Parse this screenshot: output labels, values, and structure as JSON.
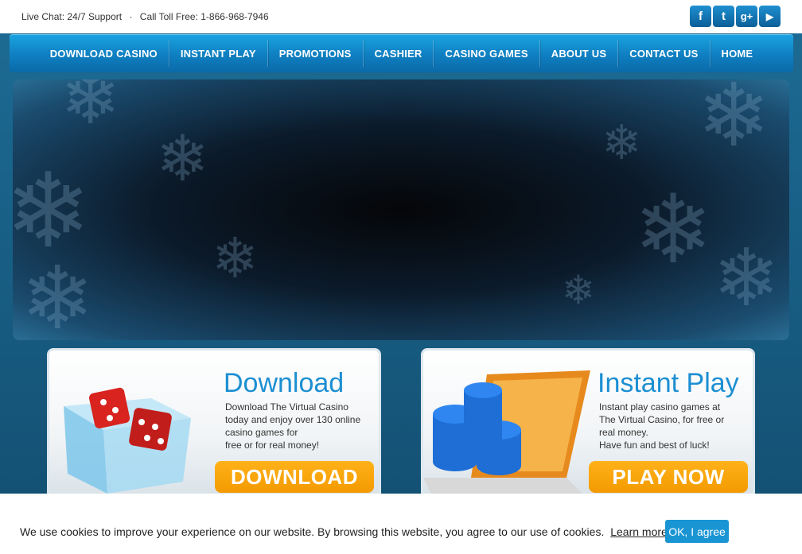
{
  "topbar": {
    "live_chat": "Live Chat: 24/7 Support",
    "separator": "·",
    "toll_free": "Call Toll Free: 1-866-968-7946"
  },
  "social": {
    "facebook_glyph": "f",
    "twitter_glyph": "t",
    "googleplus_glyph": "g+",
    "youtube_glyph": "▶"
  },
  "nav": {
    "items": [
      "DOWNLOAD CASINO",
      "INSTANT PLAY",
      "PROMOTIONS",
      "CASHIER",
      "CASINO GAMES",
      "ABOUT US",
      "CONTACT US",
      "HOME"
    ]
  },
  "download_panel": {
    "title": "Download",
    "lines": [
      "Download The Virtual Casino",
      "today and enjoy over 130 online",
      "casino games for",
      "free or for real money!"
    ],
    "button": "DOWNLOAD"
  },
  "instant_panel": {
    "title": "Instant Play",
    "lines": [
      "Instant play casino games at",
      "The Virtual Casino, for free or",
      "real money.",
      "Have fun and best of luck!"
    ],
    "button": "PLAY NOW"
  },
  "cookie": {
    "text": "We use cookies to improve your experience on our website. By browsing this website, you agree to our use of cookies.",
    "link": "Learn more.",
    "button": "OK, I agree"
  },
  "colors": {
    "nav_blue": "#1aa4e2",
    "title_blue": "#1c8fd2",
    "button_orange": "#f39a00",
    "cookie_button": "#1a95d3"
  }
}
